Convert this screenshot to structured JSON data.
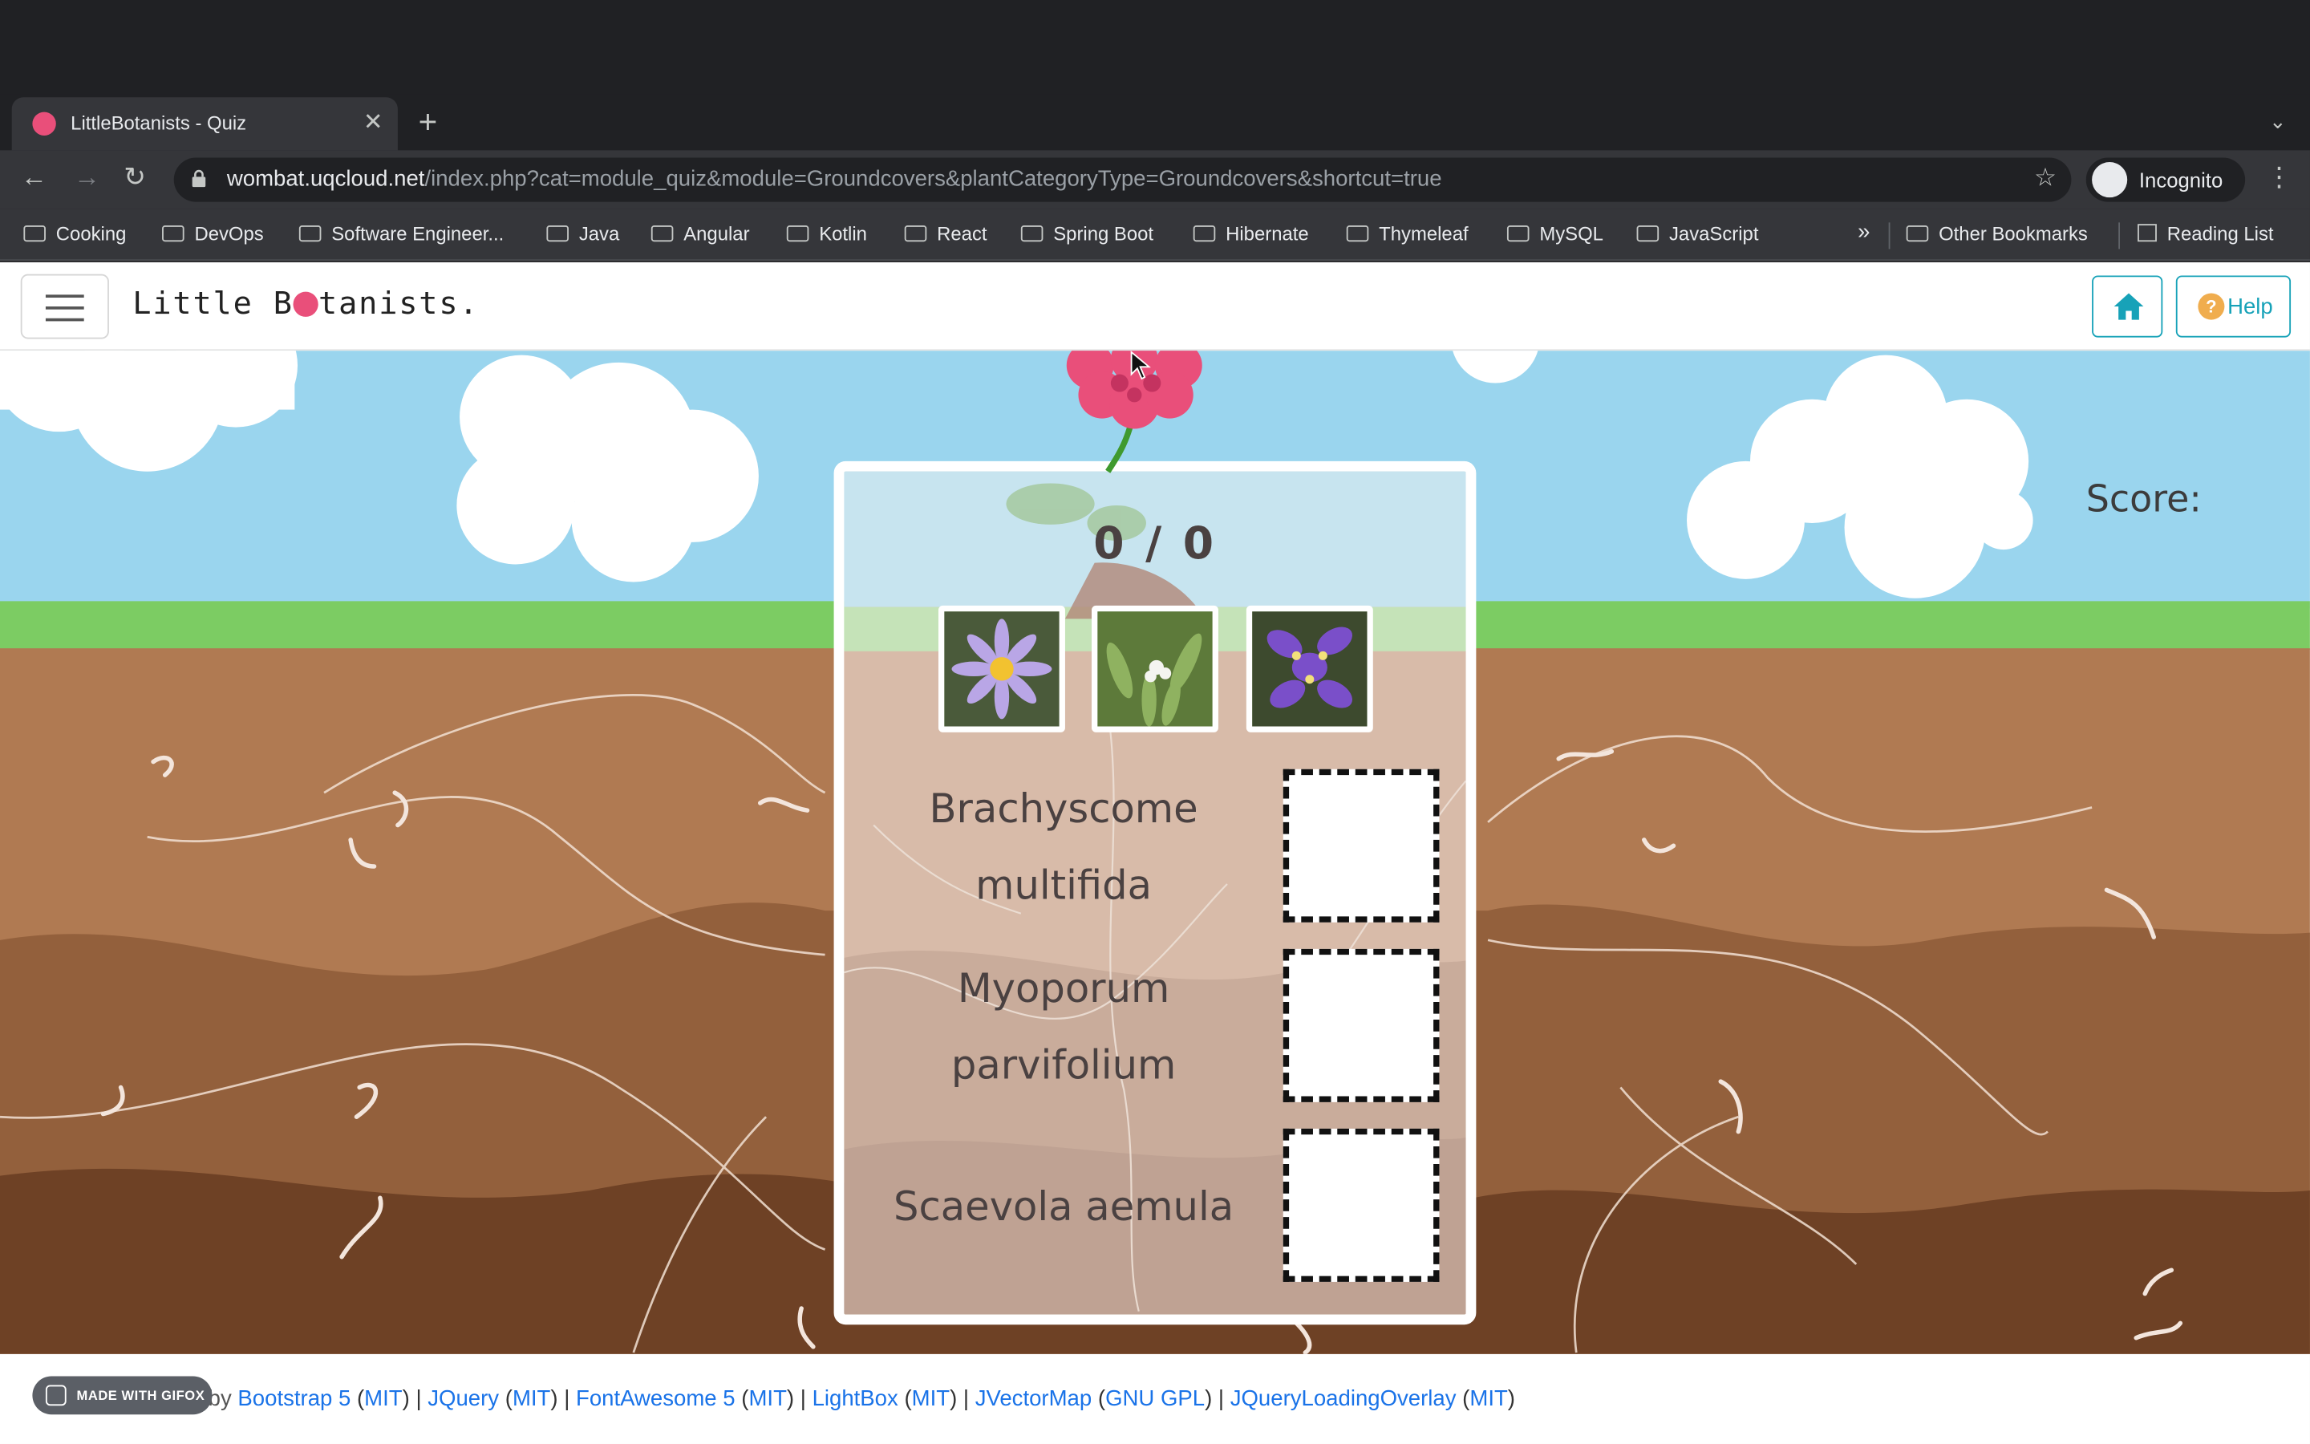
{
  "browser": {
    "tab_title": "LittleBotanists - Quiz",
    "tab_close": "✕",
    "new_tab": "+",
    "tab_menu": "⌄",
    "url_host": "wombat.uqcloud.net",
    "url_path": "/index.php?cat=module_quiz&module=Groundcovers&plantCategoryType=Groundcovers&shortcut=true",
    "profile_label": "Incognito",
    "bookmarks": [
      "Cooking",
      "DevOps",
      "Software Engineer...",
      "Java",
      "Angular",
      "Kotlin",
      "React",
      "Spring Boot",
      "Hibernate",
      "Thymeleaf",
      "MySQL",
      "JavaScript"
    ],
    "bookmarks_overflow": "»",
    "other_bookmarks": "Other Bookmarks",
    "reading_list": "Reading List"
  },
  "nav": {
    "brand_before": "Little B",
    "brand_after": "tanists.",
    "help_label": "Help",
    "help_icon_glyph": "?"
  },
  "quiz": {
    "score_label": "Score:",
    "score_value": "0 / 0",
    "plants": [
      {
        "name_line1": "Brachyscome",
        "name_line2": "multifida"
      },
      {
        "name_line1": "Myoporum",
        "name_line2": "parvifolium"
      },
      {
        "name_line1": "Scaevola aemula",
        "name_line2": ""
      }
    ],
    "thumbnails": [
      {
        "icon": "purple-daisy"
      },
      {
        "icon": "white-flower-green-leaves"
      },
      {
        "icon": "purple-fan-flower"
      }
    ]
  },
  "footer": {
    "gifox_label": "MADE WITH GIFOX",
    "powered_prefix": "Powered by",
    "libs": [
      {
        "name": "Bootstrap 5",
        "license": "MIT"
      },
      {
        "name": "JQuery",
        "license": "MIT"
      },
      {
        "name": "FontAwesome 5",
        "license": "MIT"
      },
      {
        "name": "LightBox",
        "license": "MIT"
      },
      {
        "name": "JVectorMap",
        "license": "GNU GPL"
      },
      {
        "name": "JQueryLoadingOverlay",
        "license": "MIT"
      }
    ]
  },
  "colors": {
    "sky": "#9ad5ee",
    "grass": "#7ccc63",
    "soil_light": "#b07a52",
    "soil_dark": "#6e4125",
    "accent_teal": "#17a2b8",
    "flower_pink": "#e94f7a"
  }
}
